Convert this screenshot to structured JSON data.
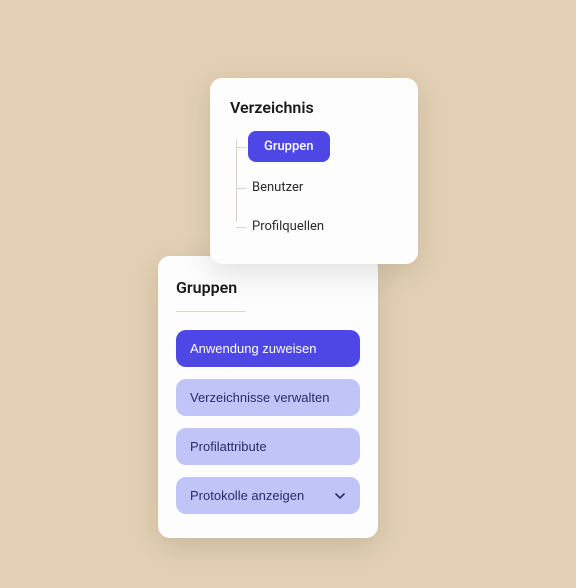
{
  "directory": {
    "title": "Verzeichnis",
    "items": [
      {
        "label": "Gruppen",
        "active": true
      },
      {
        "label": "Benutzer",
        "active": false
      },
      {
        "label": "Profilquellen",
        "active": false
      }
    ]
  },
  "groups": {
    "title": "Gruppen",
    "buttons": [
      {
        "label": "Anwendung zuweisen",
        "style": "primary"
      },
      {
        "label": "Verzeichnisse verwalten",
        "style": "secondary"
      },
      {
        "label": "Profilattribute",
        "style": "secondary"
      },
      {
        "label": "Protokolle anzeigen",
        "style": "secondary",
        "hasChevron": true
      }
    ]
  }
}
